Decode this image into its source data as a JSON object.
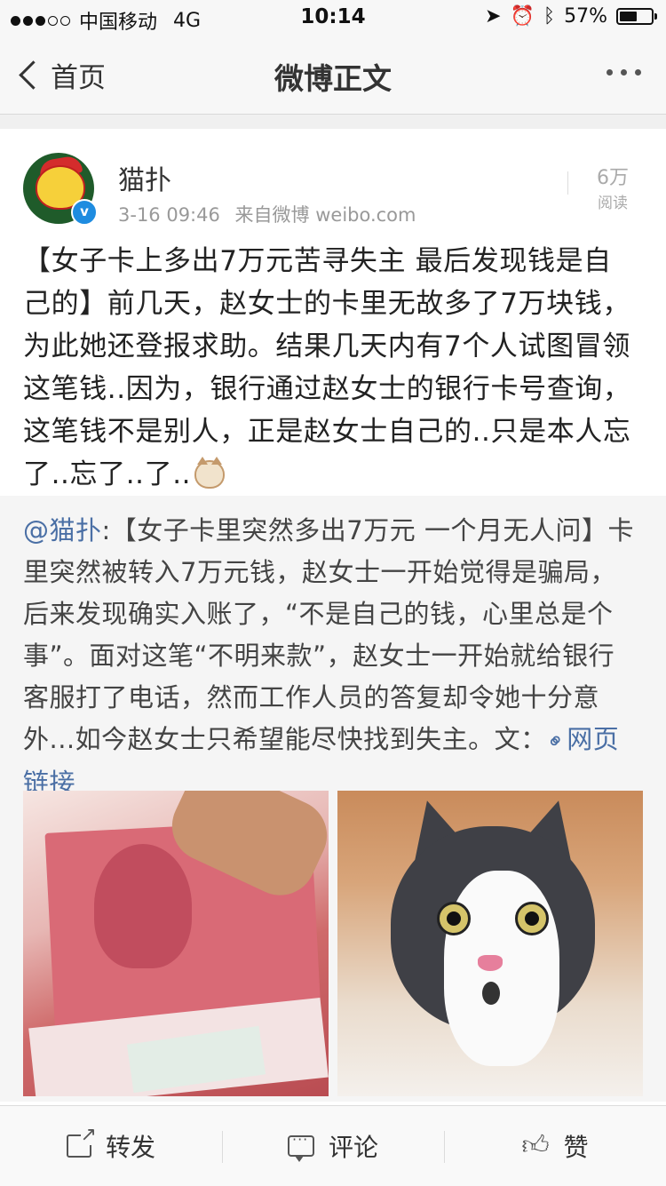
{
  "status_bar": {
    "carrier": "中国移动",
    "network": "4G",
    "time": "10:14",
    "battery_percent_text": "57%",
    "battery_level": 0.57,
    "icons": [
      "location-arrow-icon",
      "alarm-icon",
      "bluetooth-icon"
    ]
  },
  "nav": {
    "back_label": "首页",
    "title": "微博正文",
    "more_icon": "more-dots-icon"
  },
  "post": {
    "username": "猫扑",
    "timestamp": "3-16 09:46",
    "source": "来自微博 weibo.com",
    "reads_count": "6万",
    "reads_label": "阅读",
    "text": "【女子卡上多出7万元苦寻失主 最后发现钱是自己的】前几天，赵女士的卡里无故多了7万块钱，为此她还登报求助。结果几天内有7个人试图冒领这笔钱..因为，银行通过赵女士的银行卡号查询，这笔钱不是别人，正是赵女士自己的..只是本人忘了..忘了..了.."
  },
  "repost": {
    "mention": "@猫扑",
    "text": ":【女子卡里突然多出7万元 一个月无人问】卡里突然被转入7万元钱，赵女士一开始觉得是骗局，后来发现确实入账了，“不是自己的钱，心里总是个事”。面对这笔“不明来款”，赵女士一开始就给银行客服打了电话，然而工作人员的答复却令她十分意外...如今赵女士只希望能尽快找到失主。文：",
    "link_label": "网页链接",
    "images": [
      "money-photo",
      "cat-photo"
    ]
  },
  "actions": {
    "repost_label": "转发",
    "comment_label": "评论",
    "like_label": "赞"
  },
  "colors": {
    "link": "#4a6fa5",
    "verified": "#1e8ce0",
    "background_gray": "#f5f5f5"
  }
}
